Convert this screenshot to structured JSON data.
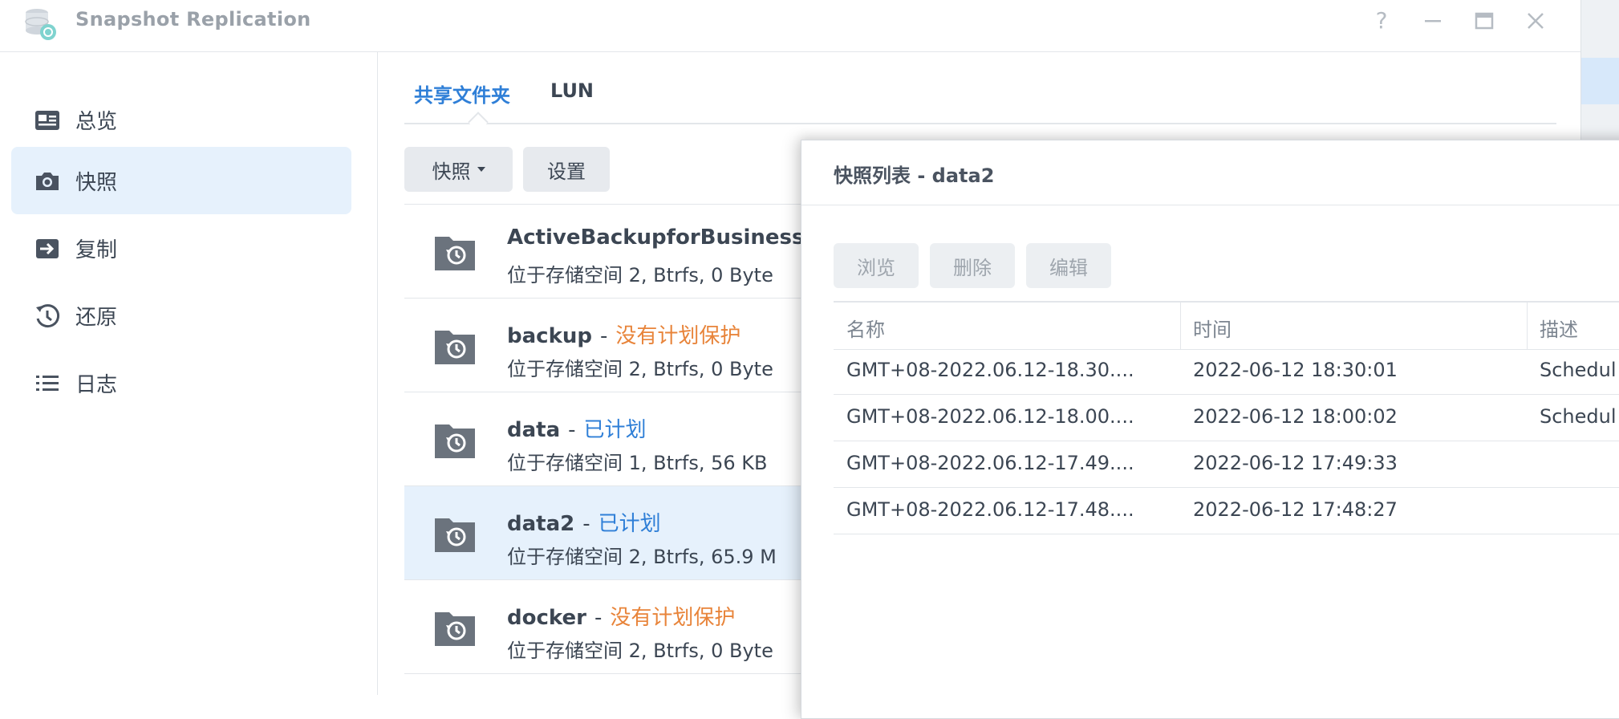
{
  "window": {
    "title": "Snapshot Replication"
  },
  "sidebar": {
    "items": [
      {
        "label": "总览",
        "icon": "overview-icon"
      },
      {
        "label": "快照",
        "icon": "camera-icon",
        "active": true
      },
      {
        "label": "复制",
        "icon": "replicate-icon"
      },
      {
        "label": "还原",
        "icon": "restore-icon"
      },
      {
        "label": "日志",
        "icon": "log-list-icon"
      }
    ]
  },
  "tabs": {
    "shared_folder": "共享文件夹",
    "lun": "LUN"
  },
  "toolbar": {
    "snapshot_label": "快照",
    "settings_label": "设置"
  },
  "folders": [
    {
      "name": "ActiveBackupforBusiness",
      "sep": "",
      "status": "",
      "status_type": "none",
      "desc": "位于存储空间 2, Btrfs, 0 Byte"
    },
    {
      "name": "backup",
      "sep": "-",
      "status": "没有计划保护",
      "status_type": "warn",
      "desc": "位于存储空间 2, Btrfs, 0 Byte"
    },
    {
      "name": "data",
      "sep": "-",
      "status": "已计划",
      "status_type": "ok",
      "desc": "位于存储空间 1, Btrfs, 56 KB"
    },
    {
      "name": "data2",
      "sep": "-",
      "status": "已计划",
      "status_type": "ok",
      "desc": "位于存储空间 2, Btrfs, 65.9 M",
      "selected": true
    },
    {
      "name": "docker",
      "sep": "-",
      "status": "没有计划保护",
      "status_type": "warn",
      "desc": "位于存储空间 2, Btrfs, 0 Byte"
    }
  ],
  "dialog": {
    "title": "快照列表 - data2",
    "buttons": {
      "browse": "浏览",
      "delete": "删除",
      "edit": "编辑"
    },
    "columns": {
      "name": "名称",
      "time": "时间",
      "desc": "描述"
    },
    "rows": [
      {
        "name": "GMT+08-2022.06.12-18.30....",
        "time": "2022-06-12 18:30:01",
        "desc": "Schedul"
      },
      {
        "name": "GMT+08-2022.06.12-18.00....",
        "time": "2022-06-12 18:00:02",
        "desc": "Schedul"
      },
      {
        "name": "GMT+08-2022.06.12-17.49....",
        "time": "2022-06-12 17:49:33",
        "desc": ""
      },
      {
        "name": "GMT+08-2022.06.12-17.48....",
        "time": "2022-06-12 17:48:27",
        "desc": ""
      }
    ]
  },
  "colors": {
    "accent": "#2f7fd7",
    "warning": "#e8843a",
    "selected_bg": "#e6f1fc"
  }
}
